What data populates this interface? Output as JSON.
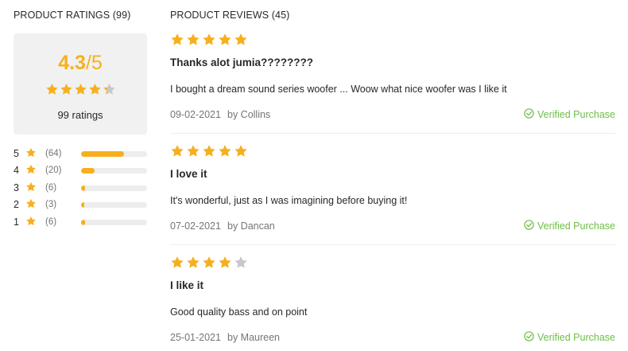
{
  "ratings": {
    "title": "PRODUCT RATINGS (99)",
    "average": "4.3",
    "max": "/5",
    "average_value": 4.3,
    "count_label": "99 ratings",
    "distribution": [
      {
        "stars": "5",
        "count": "(64)",
        "fraction": 0.646
      },
      {
        "stars": "4",
        "count": "(20)",
        "fraction": 0.202
      },
      {
        "stars": "3",
        "count": "(6)",
        "fraction": 0.061
      },
      {
        "stars": "2",
        "count": "(3)",
        "fraction": 0.03
      },
      {
        "stars": "1",
        "count": "(6)",
        "fraction": 0.061
      }
    ]
  },
  "reviews": {
    "title": "PRODUCT REVIEWS (45)",
    "items": [
      {
        "rating": 5,
        "title": "Thanks alot jumia????????",
        "body": "I bought a dream sound series woofer ... Woow what nice woofer was I like it",
        "date": "09-02-2021",
        "author": "by Collins",
        "verified": "Verified Purchase"
      },
      {
        "rating": 5,
        "title": "I love it",
        "body": "It's wonderful, just as I was imagining before buying it!",
        "date": "07-02-2021",
        "author": "by Dancan",
        "verified": "Verified Purchase"
      },
      {
        "rating": 4,
        "title": "I like it",
        "body": "Good quality bass and on point",
        "date": "25-01-2021",
        "author": "by Maureen",
        "verified": "Verified Purchase"
      }
    ]
  },
  "colors": {
    "star_filled": "#f6b01e",
    "star_empty": "#c7c7cd",
    "verified": "#6dbe45",
    "bar_track": "#ededed"
  },
  "icons": {
    "star": "star-icon",
    "verified": "check-circle-icon"
  }
}
